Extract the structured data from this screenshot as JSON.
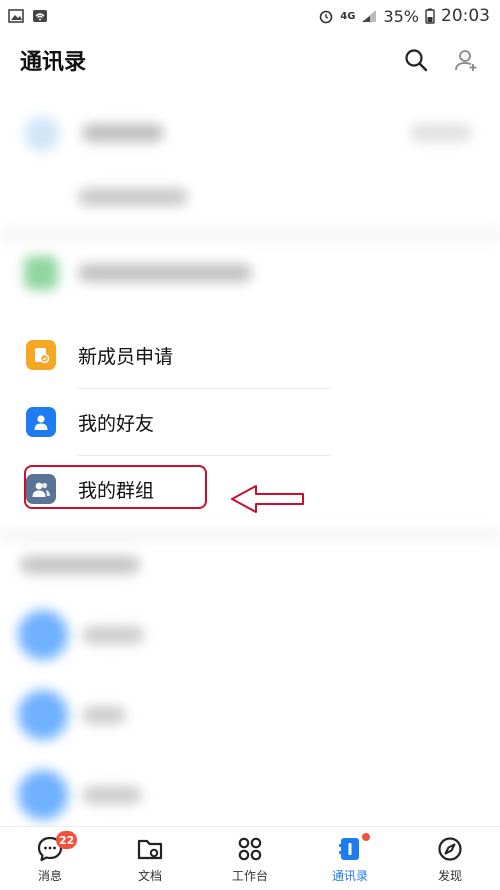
{
  "status_bar": {
    "network": "4G",
    "battery": "35%",
    "time": "20:03"
  },
  "header": {
    "title": "通讯录",
    "icons": [
      "search-icon",
      "add-contact-icon"
    ]
  },
  "menu": {
    "items": [
      {
        "label": "新成员申请",
        "icon": "new-member-icon",
        "color": "#f5a623"
      },
      {
        "label": "我的好友",
        "icon": "friend-icon",
        "color": "#1f7cf0"
      },
      {
        "label": "我的群组",
        "icon": "group-icon",
        "color": "#5a7496"
      }
    ]
  },
  "tabbar": {
    "items": [
      {
        "label": "消息",
        "icon": "message-icon",
        "badge": "22"
      },
      {
        "label": "文档",
        "icon": "folder-icon"
      },
      {
        "label": "工作台",
        "icon": "workbench-icon"
      },
      {
        "label": "通讯录",
        "icon": "contacts-icon",
        "active": true
      },
      {
        "label": "发现",
        "icon": "compass-icon"
      }
    ]
  },
  "colors": {
    "accent": "#1f7cf0",
    "highlight": "#c8102e",
    "badge": "#f4513c"
  }
}
